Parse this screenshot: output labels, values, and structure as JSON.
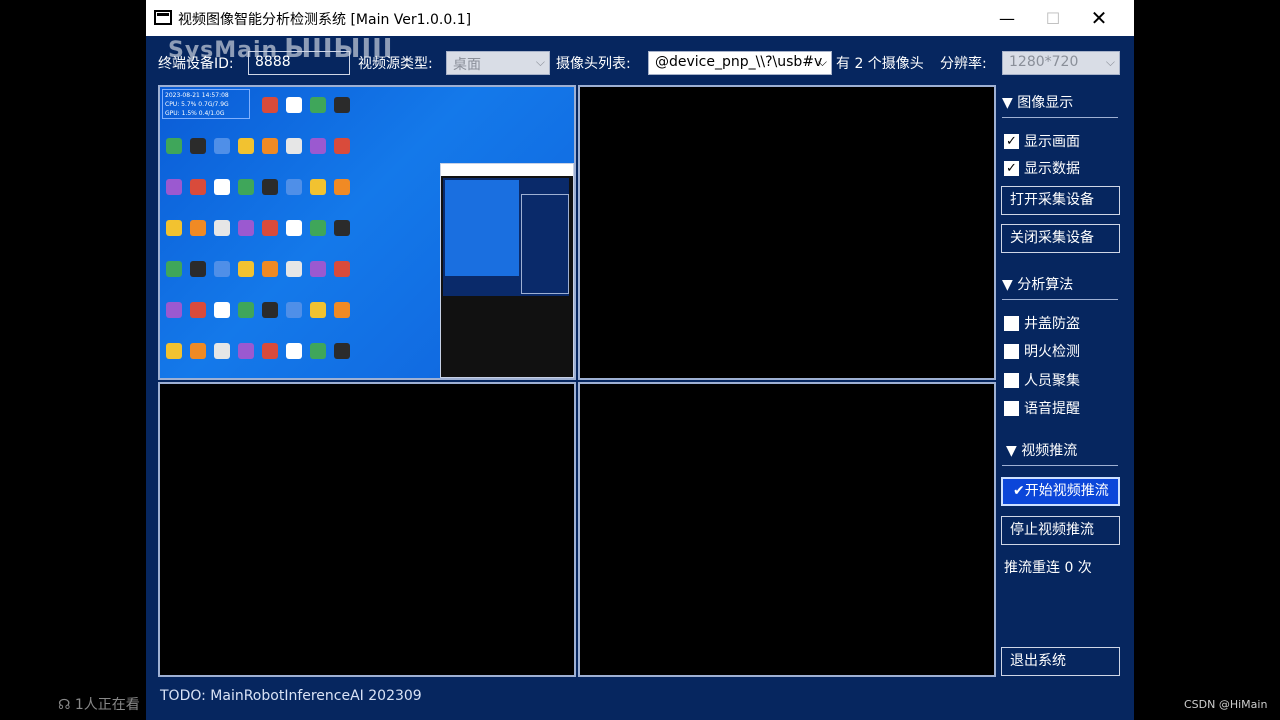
{
  "window": {
    "title": "视频图像智能分析检测系统 [Main Ver1.0.0.1]",
    "controls": {
      "minimize": "—",
      "maximize": "☐",
      "close": "✕"
    }
  },
  "watermark": {
    "text": "SysMain",
    "logo": "bilibili"
  },
  "toolbar": {
    "device_id_label": "终端设备ID:",
    "device_id_value": "8888",
    "source_type_label": "视频源类型:",
    "source_type_value": "桌面",
    "camera_list_label": "摄像头列表:",
    "camera_list_value": "@device_pnp_\\\\?\\usb#v",
    "camera_count_text": "有 2 个摄像头",
    "resolution_label": "分辨率:",
    "resolution_value": "1280*720"
  },
  "preview": {
    "overlay_lines": [
      "2023-08-21 14:57:08",
      "CPU: 5.7%  0.7G/7.9G",
      "GPU: 1.5%  0.4/1.0G"
    ]
  },
  "sidebar": {
    "display_section": "▼ 图像显示",
    "show_frame": {
      "label": "显示画面",
      "checked": true
    },
    "show_data": {
      "label": "显示数据",
      "checked": true
    },
    "open_device": "打开采集设备",
    "close_device": "关闭采集设备",
    "algorithm_section": "▼ 分析算法",
    "algorithms": [
      {
        "label": "井盖防盗",
        "checked": false
      },
      {
        "label": "明火检测",
        "checked": false
      },
      {
        "label": "人员聚集",
        "checked": false
      },
      {
        "label": "语音提醒",
        "checked": false
      }
    ],
    "stream_section": "▼ 视频推流",
    "start_stream": "✔开始视频推流",
    "stop_stream": "停止视频推流",
    "reconnect_text": "推流重连 0 次",
    "exit": "退出系统"
  },
  "footer": {
    "text": "TODO: MainRobotInferenceAI 202309"
  },
  "overlay_page": {
    "viewers": "1人正在看",
    "credit": "CSDN @HiMain"
  },
  "colors": {
    "window_bg": "#06265f",
    "active_button": "#0b46d9",
    "panel_border": "#9eb0d3"
  }
}
